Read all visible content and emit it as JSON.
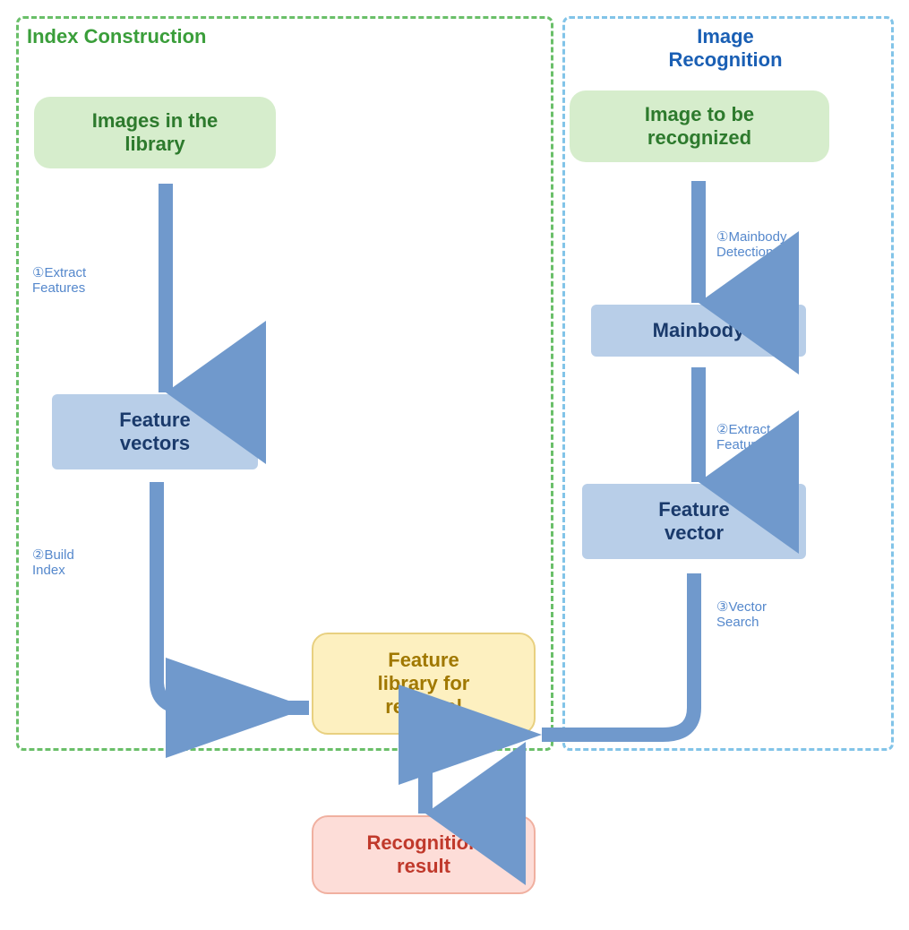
{
  "index_construction": {
    "title": "Index Construction",
    "images_in_library": "Images in the\nlibrary",
    "feature_vectors": "Feature\nvectors",
    "steps": {
      "extract_features": "①Extract\nFeatures",
      "build_index": "②Build\nIndex"
    }
  },
  "image_recognition": {
    "title": "Image\nRecognition",
    "image_to_recognize": "Image to be\nrecognized",
    "mainbody": "Mainbody",
    "feature_vector": "Feature\nvector",
    "steps": {
      "mainbody_detection": "①Mainbody\nDetection",
      "extract_feature": "②Extract\nFeature",
      "vector_search": "③Vector\nSearch"
    }
  },
  "shared": {
    "feature_library": "Feature\nlibrary for\nretrieval",
    "recognition_result": "Recognition\nresult"
  },
  "colors": {
    "green_border": "#6abf69",
    "blue_border": "#82c4e8",
    "green_text": "#3a9e3a",
    "blue_text": "#1a5fb4",
    "arrow_color": "#7099cc"
  }
}
